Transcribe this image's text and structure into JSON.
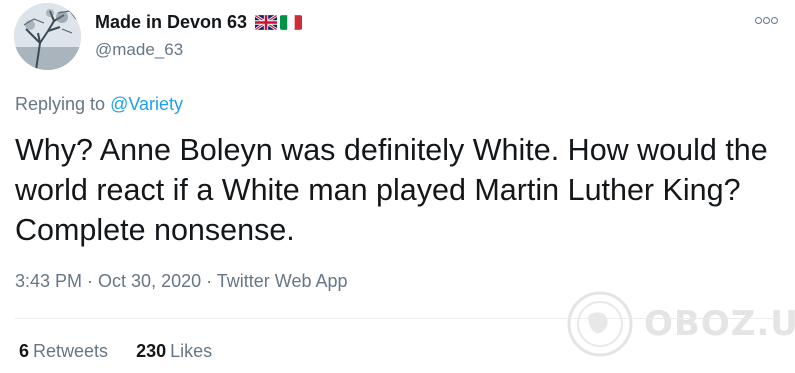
{
  "author": {
    "display_name": "Made in Devon 63",
    "handle": "@made_63",
    "avatar_icon": "avatar-photo-icon",
    "flags": [
      "uk-flag-icon",
      "italy-flag-icon"
    ]
  },
  "more_icon": "more-options-icon",
  "reply": {
    "prefix": "Replying to ",
    "mention": "@Variety"
  },
  "tweet": {
    "text": "Why? Anne Boleyn was definitely White. How would the world react if a White man played Martin Luther King? Complete nonsense."
  },
  "meta": {
    "time": "3:43 PM",
    "sep1": " · ",
    "date": "Oct 30, 2020",
    "sep2": " · ",
    "app": "Twitter Web App"
  },
  "stats": {
    "retweets_count": "6",
    "retweets_label": "Retweets",
    "likes_count": "230",
    "likes_label": "Likes"
  },
  "watermark": {
    "text": "OBOZ.UA"
  },
  "colors": {
    "text_primary": "#14171a",
    "text_secondary": "#657786",
    "link": "#1da1f2",
    "divider": "#e6ecf0"
  }
}
